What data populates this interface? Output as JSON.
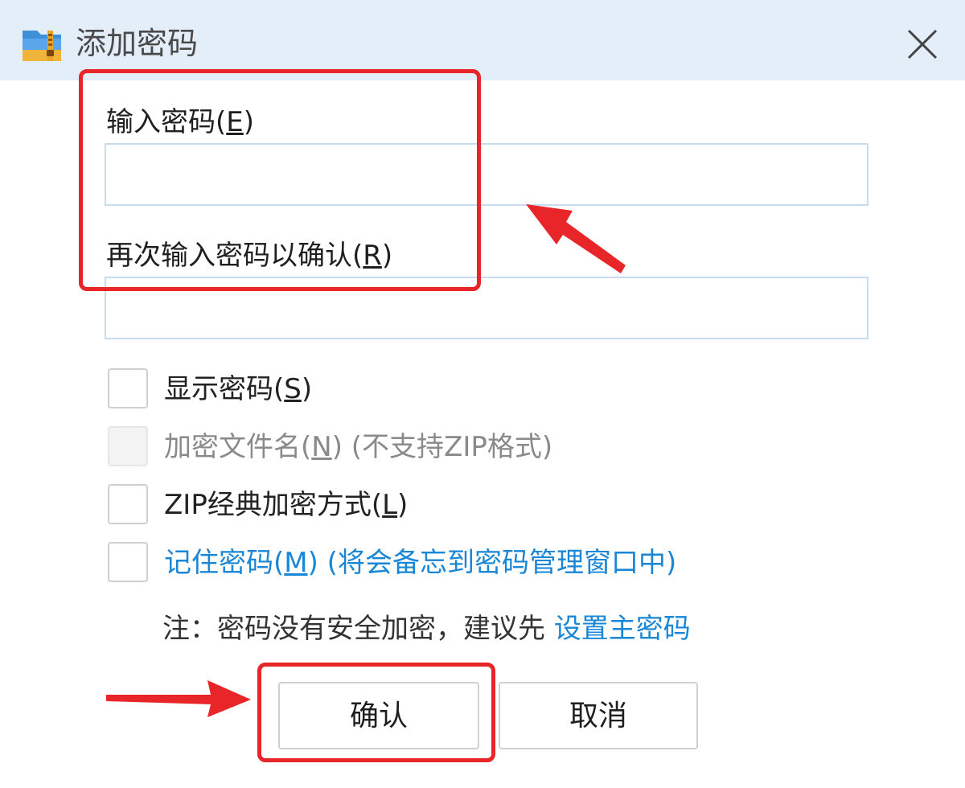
{
  "window": {
    "title": "添加密码",
    "app_icon": "archive-folder-icon",
    "close_icon": "close-icon"
  },
  "password": {
    "label_text": "输入密码(",
    "label_key": "E",
    "label_end": ")",
    "value": ""
  },
  "confirm_password": {
    "label_text": "再次输入密码以确认(",
    "label_key": "R",
    "label_end": ")",
    "value": ""
  },
  "options": [
    {
      "prefix": "显示密码(",
      "key": "S",
      "suffix": ")",
      "extra": "",
      "checked": false,
      "disabled": false
    },
    {
      "prefix": "加密文件名(",
      "key": "N",
      "suffix": ")",
      "extra": " (不支持ZIP格式)",
      "checked": false,
      "disabled": true
    },
    {
      "prefix": "ZIP经典加密方式(",
      "key": "L",
      "suffix": ")",
      "extra": "",
      "checked": false,
      "disabled": false
    },
    {
      "prefix": "记住密码(",
      "key": "M",
      "suffix": ")",
      "extra": " (将会备忘到密码管理窗口中)",
      "checked": false,
      "disabled": false
    }
  ],
  "note": {
    "text": "注：密码没有安全加密，建议先 ",
    "link": "设置主密码"
  },
  "buttons": {
    "ok": "确认",
    "cancel": "取消"
  },
  "annotation_color": "#e8262a",
  "link_color": "#1a87d6"
}
